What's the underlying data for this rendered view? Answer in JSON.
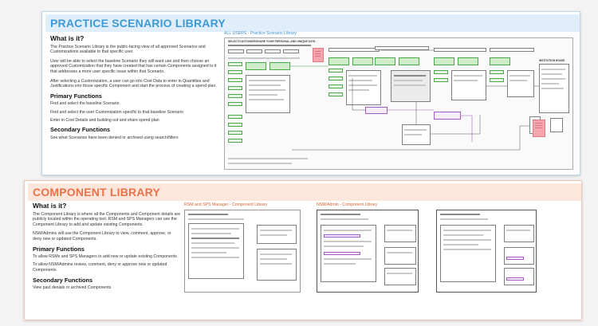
{
  "practice": {
    "banner": "PRACTICE SCENARIO LIBRARY",
    "what_heading": "What is it?",
    "paragraphs": [
      "The Practice Scenario Library is the public-facing view of all approved Scenarios and Customizations available to that specific user.",
      "User will be able to select the baseline Scenario they will want use and then choose an approved Customization that they have created that has certain Components assigned to it that addresses a more user specific issue within that Scenario.",
      "After selecting a Customization, a user can go into Cost Data to enter in Quantities and Justifications into those specific Component and start the process of creating a spend plan."
    ],
    "primary_heading": "Primary Functions",
    "primary_items": [
      "Find and select the baseline Scenario",
      "Find and select the user Customization specific to that baseline Scenario",
      "Enter in Cost Details and building out and share spend plan"
    ],
    "secondary_heading": "Secondary Functions",
    "secondary_items": [
      "See what Scenarios have been denied or archived using search/filters"
    ],
    "wireframe_title": "ALL USERS - Practice Scenario Library",
    "wireframe_header": "SELECT/CUSTOMIZE/SHARE YOUR PERSONAL AND UNIQUE DATA",
    "wireframe_side_label": "INSTITUTION HOUSE"
  },
  "component": {
    "banner": "COMPONENT LIBRARY",
    "what_heading": "What is it?",
    "paragraphs": [
      "The Component Library is where all the Components and Component details are publicly located within the operating tool. RSM and SPS Managers can use the Component Library to add and update existing Components.",
      "NSM/Admins will use the Component Library to view, comment, approve, or deny new or updated Components."
    ],
    "primary_heading": "Primary Functions",
    "primary_items": [
      "To allow RSMs and SPS Managers to add new or update existing Components",
      "To allow NSM/Admins review, comment, deny or approve new or updated Components"
    ],
    "secondary_heading": "Secondary Functions",
    "secondary_items": [
      "View past denials or archived Components"
    ],
    "wf1_title": "RSM and SPS Manager - Component Library",
    "wf2_title": "NSM/Admin - Component Library"
  },
  "colors": {
    "practice_accent": "#3d9ad6",
    "component_accent": "#e8724a"
  }
}
